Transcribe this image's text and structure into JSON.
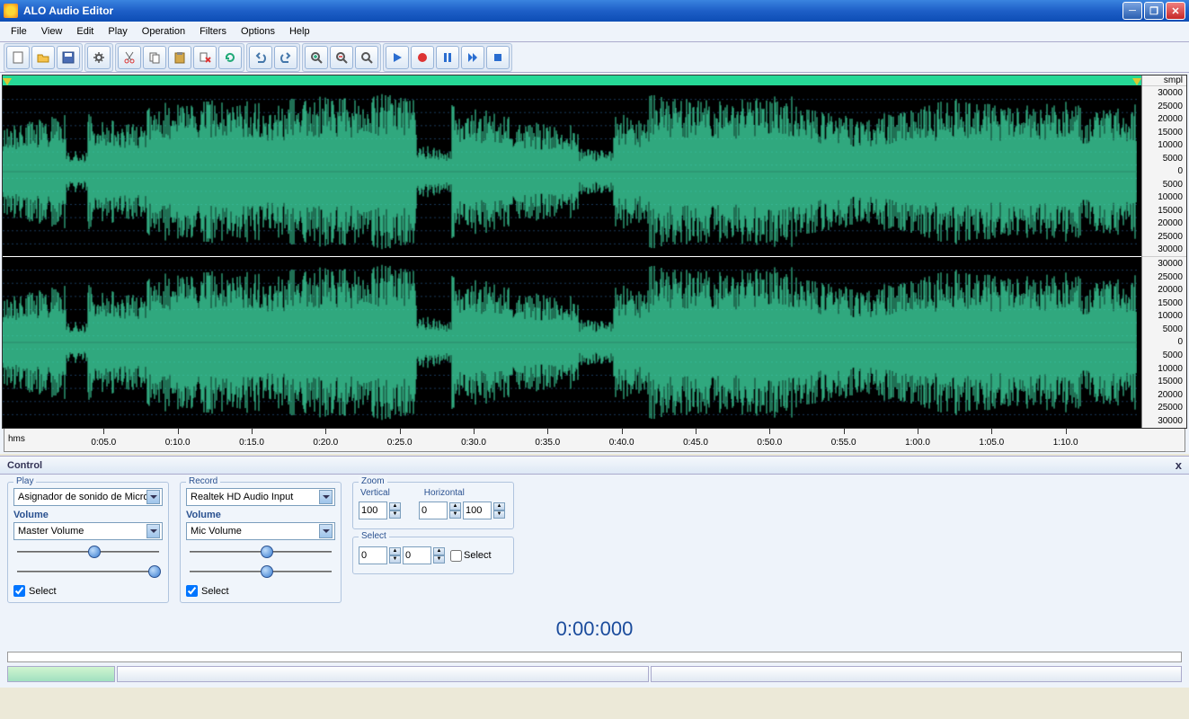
{
  "window": {
    "title": "ALO Audio Editor"
  },
  "menu": {
    "items": [
      "File",
      "View",
      "Edit",
      "Play",
      "Operation",
      "Filters",
      "Options",
      "Help"
    ]
  },
  "toolbar": {
    "groups": [
      [
        "new",
        "open",
        "save"
      ],
      [
        "settings"
      ],
      [
        "cut",
        "copy",
        "paste",
        "delete",
        "refresh"
      ],
      [
        "undo",
        "redo"
      ],
      [
        "zoom-in",
        "zoom-out",
        "zoom-fit"
      ],
      [
        "play",
        "record",
        "pause",
        "forward",
        "stop"
      ]
    ]
  },
  "amplitude": {
    "unit": "smpl",
    "labels": [
      "30000",
      "25000",
      "20000",
      "15000",
      "10000",
      "5000",
      "0",
      "5000",
      "10000",
      "15000",
      "20000",
      "25000",
      "30000"
    ]
  },
  "timeline": {
    "unit": "hms",
    "marks": [
      "0:05.0",
      "0:10.0",
      "0:15.0",
      "0:20.0",
      "0:25.0",
      "0:30.0",
      "0:35.0",
      "0:40.0",
      "0:45.0",
      "0:50.0",
      "0:55.0",
      "1:00.0",
      "1:05.0",
      "1:10.0"
    ]
  },
  "control": {
    "title": "Control",
    "play": {
      "legend": "Play",
      "device": "Asignador de sonido de Micro",
      "volume_label": "Volume",
      "mixer": "Master Volume",
      "select_label": "Select"
    },
    "record": {
      "legend": "Record",
      "device": "Realtek HD Audio Input",
      "volume_label": "Volume",
      "mixer": "Mic Volume",
      "select_label": "Select"
    },
    "zoom": {
      "legend": "Zoom",
      "vertical_label": "Vertical",
      "horizontal_label": "Horizontal",
      "vertical": "100",
      "h1": "0",
      "h2": "100"
    },
    "select": {
      "legend": "Select",
      "from": "0",
      "to": "0",
      "checkbox_label": "Select"
    }
  },
  "time_display": "0:00:000"
}
